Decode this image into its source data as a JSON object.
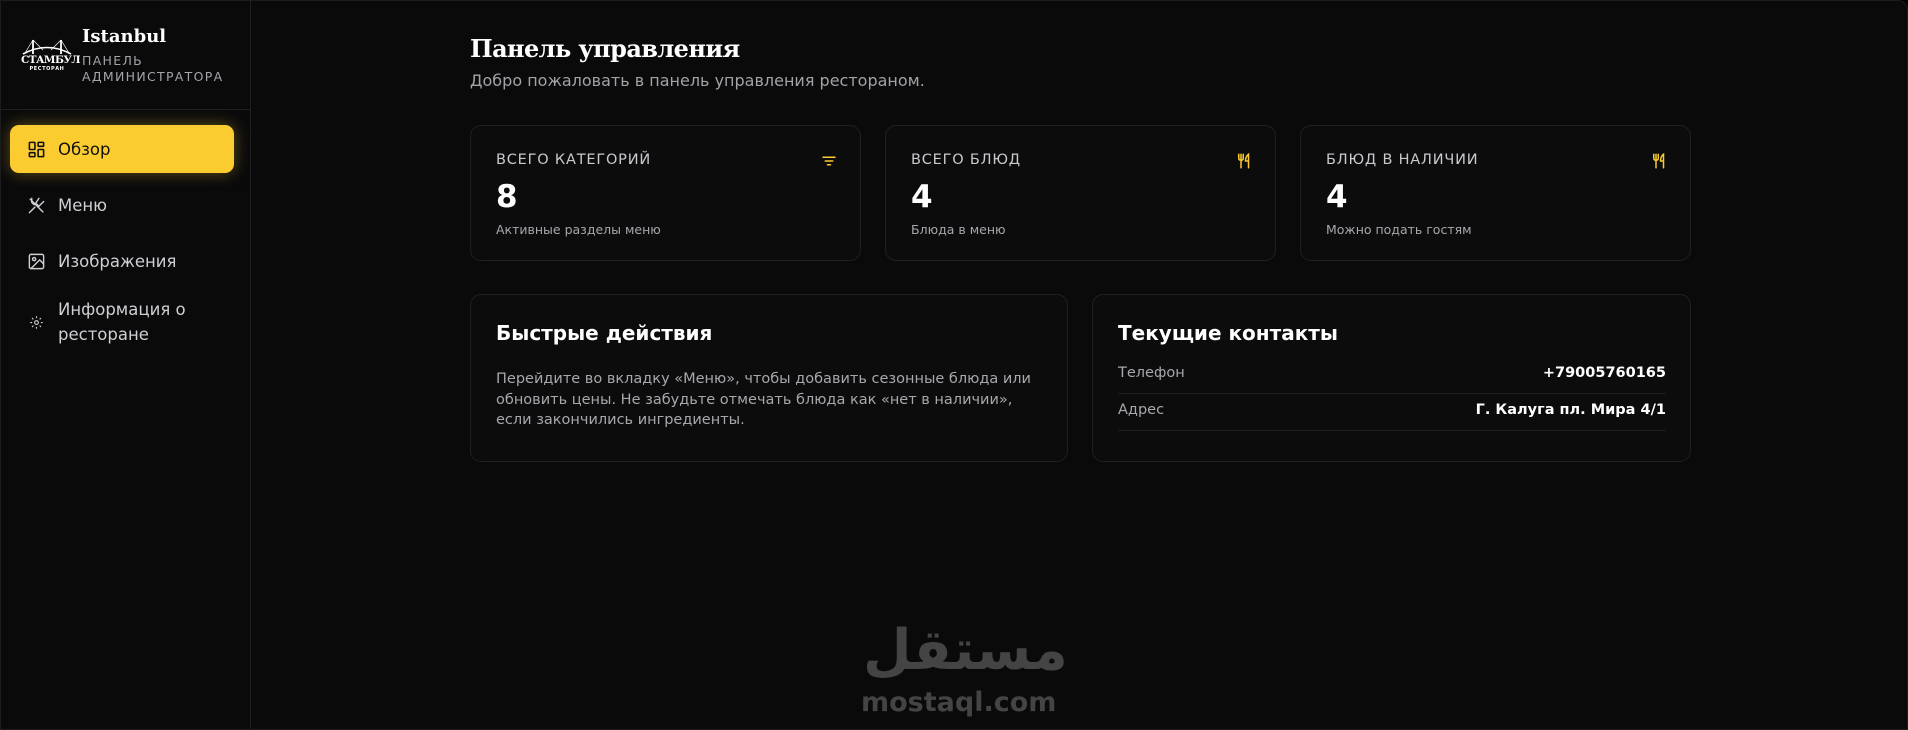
{
  "sidebar": {
    "logo": {
      "word": "СТАМБУЛ",
      "sub": "РЕСТОРАН"
    },
    "brand_name": "Istanbul",
    "brand_sub": "Панель администратора",
    "items": [
      {
        "label": "Обзор",
        "icon": "dashboard-icon",
        "active": true
      },
      {
        "label": "Меню",
        "icon": "utensils-crossed-icon",
        "active": false
      },
      {
        "label": "Изображения",
        "icon": "image-icon",
        "active": false
      },
      {
        "label": "Информация о ресторане",
        "icon": "gear-icon",
        "active": false
      }
    ]
  },
  "main": {
    "title": "Панель управления",
    "subtitle": "Добро пожаловать в панель управления рестораном.",
    "stats": [
      {
        "title": "Всего категорий",
        "value": "8",
        "caption": "Активные разделы меню",
        "icon": "filter-icon"
      },
      {
        "title": "Всего блюд",
        "value": "4",
        "caption": "Блюда в меню",
        "icon": "fork-knife-icon"
      },
      {
        "title": "Блюд в наличии",
        "value": "4",
        "caption": "Можно подать гостям",
        "icon": "fork-knife-icon"
      }
    ],
    "quick_actions": {
      "title": "Быстрые действия",
      "text": "Перейдите во вкладку «Меню», чтобы добавить сезонные блюда или обновить цены. Не забудьте отмечать блюда как «нет в наличии», если закончились ингредиенты."
    },
    "contacts": {
      "title": "Текущие контакты",
      "rows": [
        {
          "label": "Телефон",
          "value": "+79005760165"
        },
        {
          "label": "Адрес",
          "value": "Г. Калуга пл. Мира 4/1"
        }
      ]
    }
  },
  "watermark": {
    "arabic": "مستقل",
    "latin": "mostaql.com"
  },
  "colors": {
    "accent": "#fbcc2f",
    "background": "#0a0a0b",
    "border": "#202023",
    "muted_text": "#a7a7ad"
  }
}
